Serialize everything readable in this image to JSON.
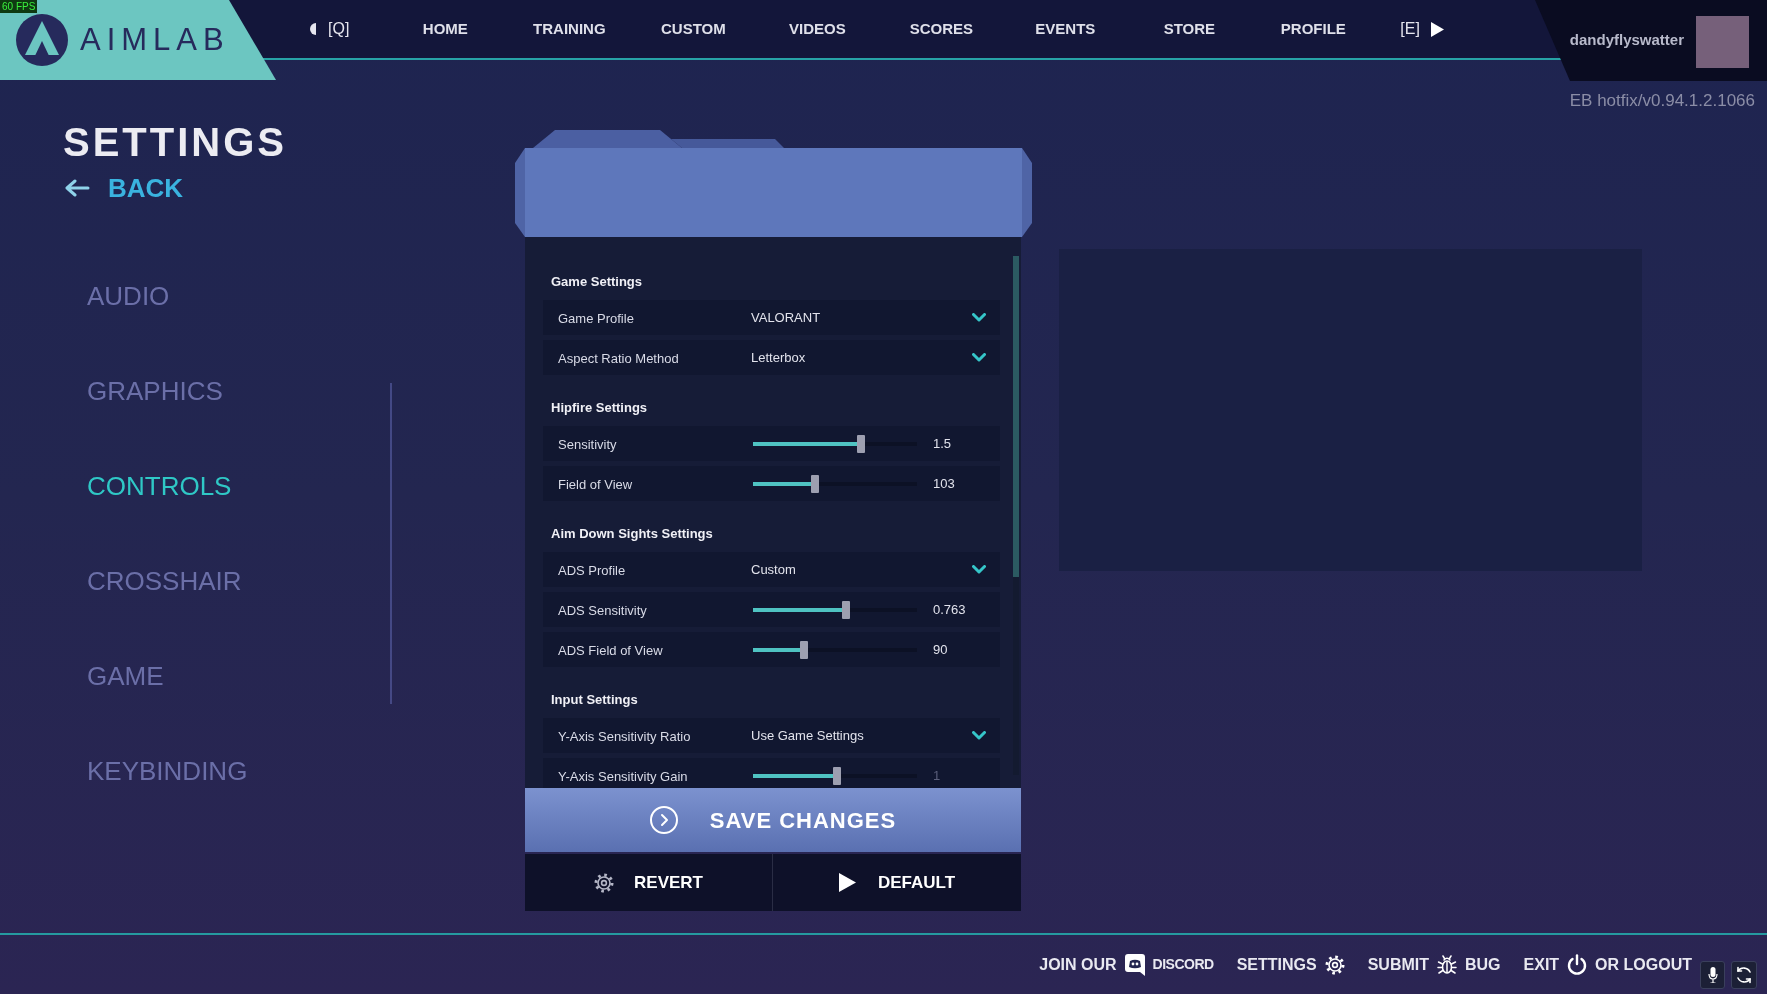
{
  "fps_counter": "60 FPS",
  "logo": {
    "text": "AIMLAB"
  },
  "top_nav": {
    "previous_key": "[Q]",
    "items": [
      "HOME",
      "TRAINING",
      "CUSTOM",
      "VIDEOS",
      "SCORES",
      "EVENTS",
      "STORE",
      "PROFILE"
    ],
    "next_key": "[E]"
  },
  "user": {
    "name": "dandyflyswatter"
  },
  "version": "EB hotfix/v0.94.1.2.1066",
  "sidebar": {
    "title": "SETTINGS",
    "back": "BACK",
    "items": [
      {
        "label": "AUDIO",
        "selected": false
      },
      {
        "label": "GRAPHICS",
        "selected": false
      },
      {
        "label": "CONTROLS",
        "selected": true
      },
      {
        "label": "CROSSHAIR",
        "selected": false
      },
      {
        "label": "GAME",
        "selected": false
      },
      {
        "label": "KEYBINDING",
        "selected": false
      }
    ]
  },
  "settings_panel": {
    "sections": [
      {
        "title": "Game Settings",
        "rows": [
          {
            "kind": "dropdown",
            "label": "Game Profile",
            "value": "VALORANT",
            "disabled": false
          },
          {
            "kind": "dropdown",
            "label": "Aspect Ratio Method",
            "value": "Letterbox",
            "disabled": false
          }
        ]
      },
      {
        "title": "Hipfire Settings",
        "rows": [
          {
            "kind": "slider",
            "label": "Sensitivity",
            "level": 0.66,
            "reading": "1.5",
            "disabled": false
          },
          {
            "kind": "slider",
            "label": "Field of View",
            "level": 0.38,
            "reading": "103",
            "disabled": false
          }
        ]
      },
      {
        "title": "Aim Down Sights Settings",
        "rows": [
          {
            "kind": "dropdown",
            "label": "ADS Profile",
            "value": "Custom",
            "disabled": false
          },
          {
            "kind": "slider",
            "label": "ADS Sensitivity",
            "level": 0.57,
            "reading": "0.763",
            "disabled": false
          },
          {
            "kind": "slider",
            "label": "ADS Field of View",
            "level": 0.31,
            "reading": "90",
            "disabled": false
          }
        ]
      },
      {
        "title": "Input Settings",
        "rows": [
          {
            "kind": "dropdown",
            "label": "Y-Axis Sensitivity Ratio",
            "value": "Use Game Settings",
            "disabled": false
          },
          {
            "kind": "slider",
            "label": "Y-Axis Sensitivity Gain",
            "level": 0.51,
            "reading": "1",
            "disabled": true
          }
        ]
      }
    ],
    "save_button": "SAVE CHANGES",
    "revert_button": "REVERT",
    "default_button": "DEFAULT"
  },
  "footer": {
    "links": [
      {
        "kind": "discord",
        "text": "JOIN OUR",
        "text_after": "DISCORD"
      },
      {
        "kind": "settings",
        "text": "SETTINGS"
      },
      {
        "kind": "bug",
        "text": "SUBMIT",
        "text_after": "BUG"
      },
      {
        "kind": "power",
        "text": "EXIT",
        "text_after": "OR LOGOUT"
      }
    ]
  }
}
